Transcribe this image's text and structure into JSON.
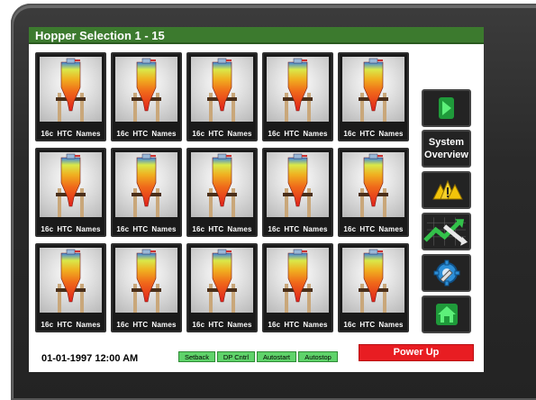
{
  "window": {
    "title": "Hopper Selection 1 - 15"
  },
  "hoppers": [
    {
      "num": "16c",
      "a": "HTC",
      "b": "Names"
    },
    {
      "num": "16c",
      "a": "HTC",
      "b": "Names"
    },
    {
      "num": "16c",
      "a": "HTC",
      "b": "Names"
    },
    {
      "num": "16c",
      "a": "HTC",
      "b": "Names"
    },
    {
      "num": "16c",
      "a": "HTC",
      "b": "Names"
    },
    {
      "num": "16c",
      "a": "HTC",
      "b": "Names"
    },
    {
      "num": "16c",
      "a": "HTC",
      "b": "Names"
    },
    {
      "num": "16c",
      "a": "HTC",
      "b": "Names"
    },
    {
      "num": "16c",
      "a": "HTC",
      "b": "Names"
    },
    {
      "num": "16c",
      "a": "HTC",
      "b": "Names"
    },
    {
      "num": "16c",
      "a": "HTC",
      "b": "Names"
    },
    {
      "num": "16c",
      "a": "HTC",
      "b": "Names"
    },
    {
      "num": "16c",
      "a": "HTC",
      "b": "Names"
    },
    {
      "num": "16c",
      "a": "HTC",
      "b": "Names"
    },
    {
      "num": "16c",
      "a": "HTC",
      "b": "Names"
    }
  ],
  "sidebar": {
    "next_icon": "arrow-right-icon",
    "system_overview_line1": "System",
    "system_overview_line2": "Overview",
    "alarm_icon": "alarm-icon",
    "trend_icon": "trend-icon",
    "settings_icon": "wrench-gear-icon",
    "home_icon": "home-icon"
  },
  "footer": {
    "datetime": "01-01-1997 12:00 AM",
    "status": [
      "Setback",
      "DP Cntrl",
      "Autostart",
      "Autostop"
    ],
    "power_button": "Power Up"
  },
  "colors": {
    "titlebar": "#3c7a2e",
    "status_green": "#5fd36a",
    "power_red": "#e81d22",
    "button_green": "#33c14a"
  }
}
